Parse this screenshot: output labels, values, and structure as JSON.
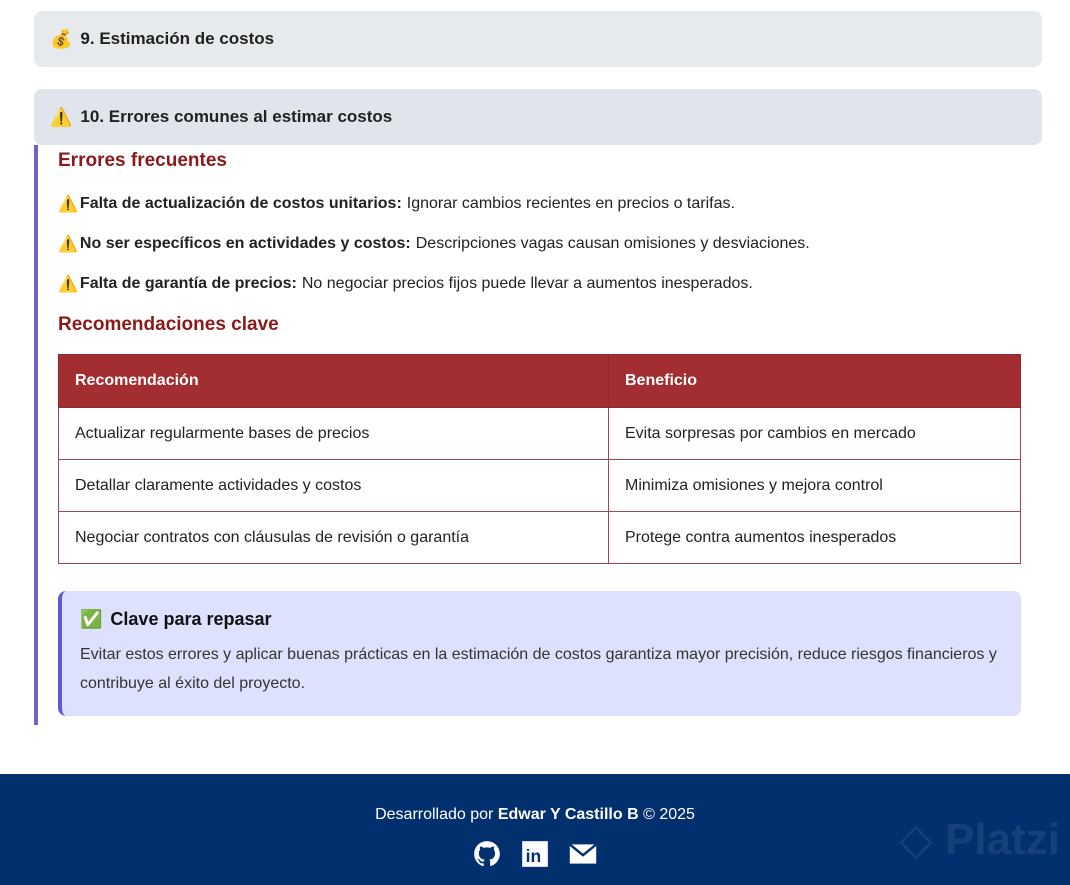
{
  "sections": [
    {
      "icon": "💰",
      "title": "9. Estimación de costos"
    },
    {
      "icon": "⚠️",
      "title": "10. Errores comunes al estimar costos"
    }
  ],
  "errores": {
    "heading": "Errores frecuentes",
    "items": [
      {
        "label": "Falta de actualización de costos unitarios:",
        "text": "Ignorar cambios recientes en precios o tarifas."
      },
      {
        "label": "No ser específicos en actividades y costos:",
        "text": "Descripciones vagas causan omisiones y desviaciones."
      },
      {
        "label": "Falta de garantía de precios:",
        "text": "No negociar precios fijos puede llevar a aumentos inesperados."
      }
    ]
  },
  "recomendaciones": {
    "heading": "Recomendaciones clave",
    "headers": [
      "Recomendación",
      "Beneficio"
    ],
    "rows": [
      [
        "Actualizar regularmente bases de precios",
        "Evita sorpresas por cambios en mercado"
      ],
      [
        "Detallar claramente actividades y costos",
        "Minimiza omisiones y mejora control"
      ],
      [
        "Negociar contratos con cláusulas de revisión o garantía",
        "Protege contra aumentos inesperados"
      ]
    ]
  },
  "clave": {
    "icon": "✅",
    "title": "Clave para repasar",
    "text": "Evitar estos errores y aplicar buenas prácticas en la estimación de costos garantiza mayor precisión, reduce riesgos financieros y contribuye al éxito del proyecto."
  },
  "footer": {
    "prefix": "Desarrollado por",
    "author": "Edwar Y Castillo B",
    "suffix": "© 2025",
    "watermark": "Platzi"
  }
}
